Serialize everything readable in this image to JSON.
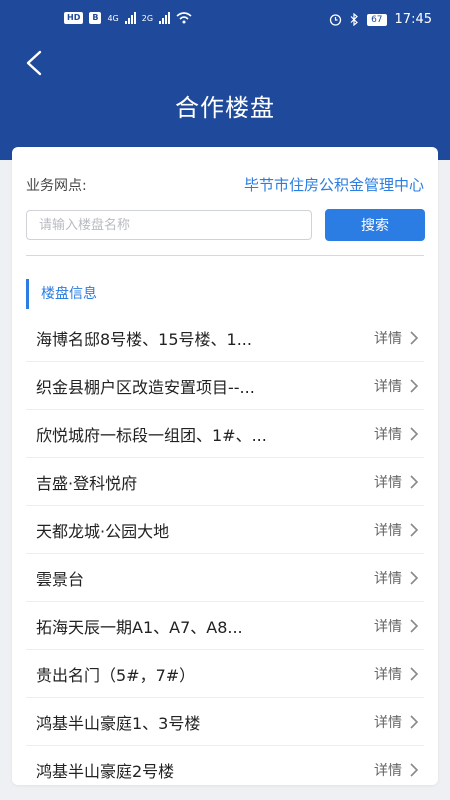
{
  "status_bar": {
    "left_badges": [
      "HD",
      "B"
    ],
    "network_1": "4G",
    "network_2": "2G",
    "battery": "67",
    "time": "17:45",
    "icons": [
      "signal-icon",
      "wifi-icon",
      "alarm-icon",
      "bluetooth-icon",
      "battery-icon"
    ]
  },
  "header": {
    "title": "合作楼盘",
    "back_icon": "back-arrow-icon",
    "bg_color": "#1f4a9c"
  },
  "filter": {
    "branch_label": "业务网点:",
    "branch_value": "毕节市住房公积金管理中心",
    "search_placeholder": "请输入楼盘名称",
    "search_button": "搜索"
  },
  "section": {
    "title": "楼盘信息"
  },
  "properties": [
    {
      "name": "海博名邸8号楼、15号楼、1...",
      "action": "详情"
    },
    {
      "name": "织金县棚户区改造安置项目--...",
      "action": "详情"
    },
    {
      "name": "欣悦城府一标段一组团、1#、...",
      "action": "详情"
    },
    {
      "name": "吉盛·登科悦府",
      "action": "详情"
    },
    {
      "name": "天都龙城·公园大地",
      "action": "详情"
    },
    {
      "name": "雲景台",
      "action": "详情"
    },
    {
      "name": "拓海天辰一期A1、A7、A8...",
      "action": "详情"
    },
    {
      "name": "贵出名门（5#，7#）",
      "action": "详情"
    },
    {
      "name": "鸿基半山豪庭1、3号楼",
      "action": "详情"
    },
    {
      "name": "鸿基半山豪庭2号楼",
      "action": "详情"
    }
  ],
  "colors": {
    "accent": "#2b7de3",
    "link": "#2a7de1"
  }
}
